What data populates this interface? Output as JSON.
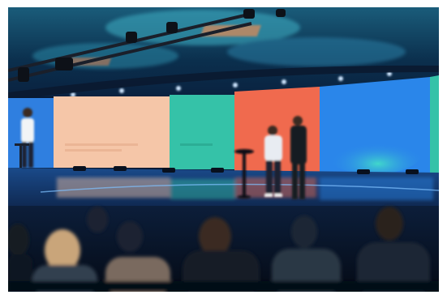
{
  "scene": {
    "description_hidden": "",
    "colors": {
      "ceiling": "#0b3a5a",
      "stage_floor": "#0d2a52",
      "panel_blue_left": "#2f7fe0",
      "panel_peach": "#f5c6a8",
      "panel_teal": "#35c2a8",
      "panel_coral": "#f06a4e",
      "panel_blue": "#2a86ea",
      "audience": "#0a1322"
    },
    "screens": [
      {
        "text": ""
      },
      {
        "text": ""
      },
      {
        "text": ""
      },
      {
        "text": ""
      }
    ]
  }
}
